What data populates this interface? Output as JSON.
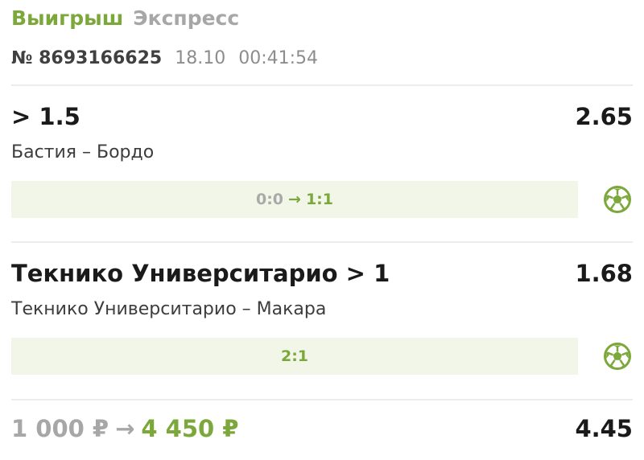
{
  "header": {
    "status": "Выигрыш",
    "bet_type": "Экспресс"
  },
  "meta": {
    "bet_number": "№ 8693166625",
    "date": "18.10",
    "time": "00:41:54"
  },
  "events": [
    {
      "outcome": "> 1.5",
      "odds": "2.65",
      "match": "Бастия – Бордо",
      "score_from": "0:0",
      "score_arrow": "→",
      "score_to": "1:1",
      "sport_icon": "soccer-ball-icon"
    },
    {
      "outcome": "Текнико Университарио > 1",
      "odds": "1.68",
      "match": "Текнико Университарио – Макара",
      "score": "2:1",
      "sport_icon": "soccer-ball-icon"
    }
  ],
  "footer": {
    "stake": "1 000 ₽",
    "arrow": "→",
    "payout": "4 450 ₽",
    "total_odds": "4.45"
  },
  "colors": {
    "accent": "#7ca83b",
    "muted": "#a7a7a7",
    "score_bar_bg": "#f2f6e8",
    "divider": "#ececec"
  }
}
